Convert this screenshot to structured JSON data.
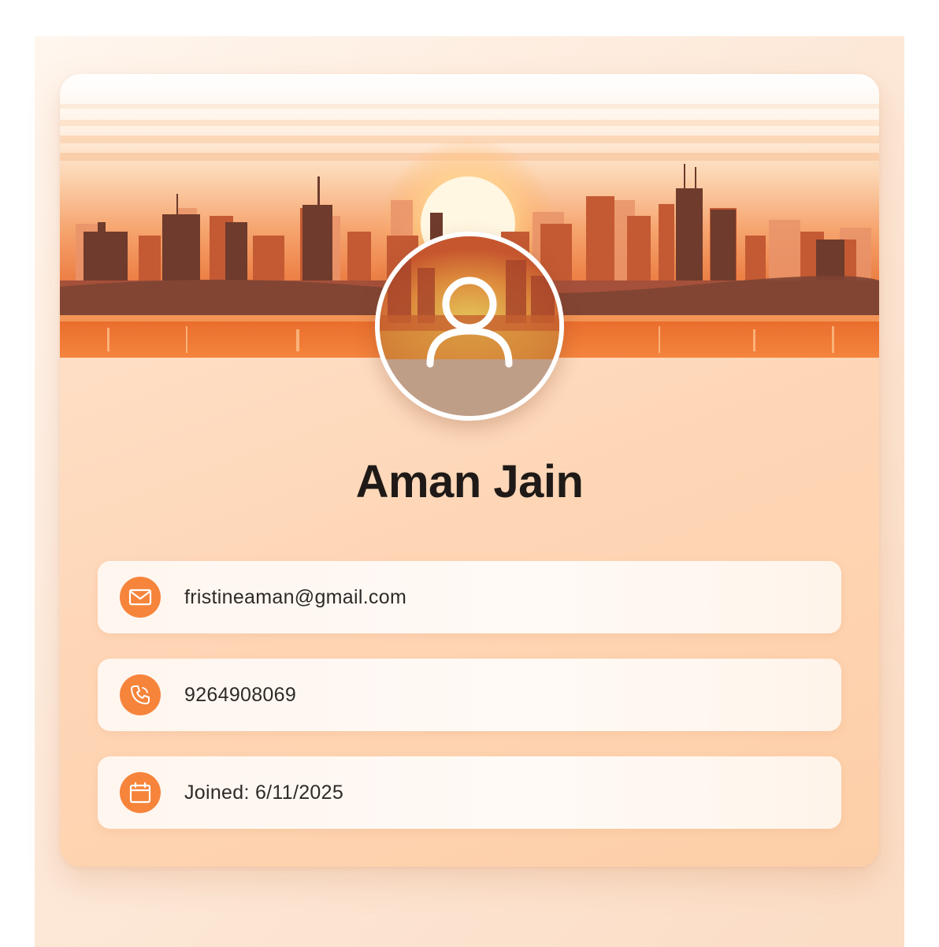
{
  "profile": {
    "name": "Aman Jain",
    "email": "fristineaman@gmail.com",
    "phone": "9264908069",
    "joined": "Joined: 6/11/2025"
  },
  "icons": {
    "avatar": "user-icon",
    "email": "mail-icon",
    "phone": "phone-icon",
    "joined": "calendar-icon"
  },
  "colors": {
    "accent": "#f6843b",
    "card_bg": "#fed6b6",
    "row_bg": "#fffaf6",
    "name_text": "#1f1a17"
  }
}
